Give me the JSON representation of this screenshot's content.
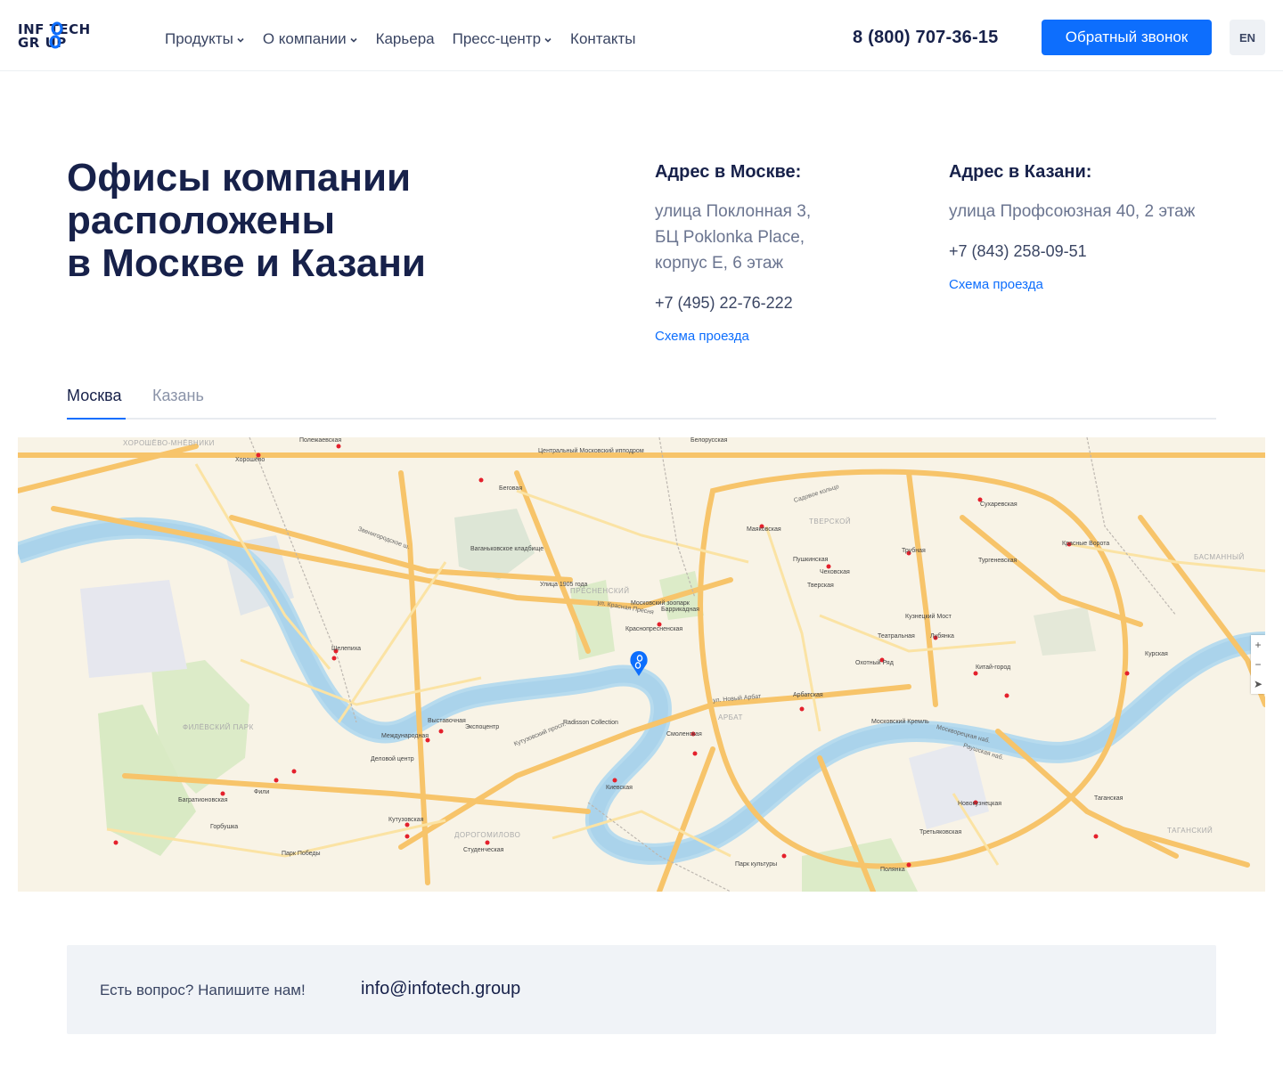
{
  "brand": {
    "line1": "INF TECH",
    "line2": "GR UP",
    "accent": "#0d6efd",
    "dark": "#17214a"
  },
  "nav": [
    {
      "label": "Продукты",
      "dropdown": true
    },
    {
      "label": "О компании",
      "dropdown": true
    },
    {
      "label": "Карьера",
      "dropdown": false
    },
    {
      "label": "Пресс-центр",
      "dropdown": true
    },
    {
      "label": "Контакты",
      "dropdown": false
    }
  ],
  "header": {
    "phone": "8 (800) 707-36-15",
    "callback_label": "Обратный звонок",
    "lang": "EN"
  },
  "title": {
    "line1": "Офисы компании",
    "line2": "расположены",
    "line3": "в Москве и Казани"
  },
  "moscow": {
    "heading": "Адрес в Москве:",
    "street1": "улица Поклонная 3,",
    "street2": "БЦ Poklonka Place,",
    "street3": "корпус Е, 6 этаж",
    "phone": "+7 (495) 22-76-222",
    "route": "Схема проезда"
  },
  "kazan": {
    "heading": "Адрес в Казани:",
    "street1": "улица Профсоюзная 40, 2 этаж",
    "phone": "+7 (843) 258-09-51",
    "route": "Схема проезда"
  },
  "tabs": {
    "moscow": "Москва",
    "kazan": "Казань",
    "active": "Москва"
  },
  "map": {
    "labels": {
      "khoroshevo": "ХОРОШЁВО-МНЁВНИКИ",
      "presnensky": "ПРЕСНЕНСКИЙ",
      "arbat": "АРБАТ",
      "tverskoy": "ТВЕРСКОЙ",
      "basmanny": "БАСМАННЫЙ",
      "tagansky": "ТАГАНСКИЙ",
      "dorogomilovo": "ДОРОГОМИЛОВО",
      "filevsky_park": "ФИЛЁВСКИЙ ПАРК",
      "kutuzovsky": "Кутузовский просп.",
      "novy_arbat": "ул. Новый Арбат",
      "krasnaya_presnya": "ул. Красная Пресня",
      "zvenigorodskoe": "Звенигородское ш.",
      "sadovoe": "Садовое кольцо",
      "moskvoretskaya": "Москворецкая наб.",
      "kievskaya": "Киевская",
      "smolenskaya": "Смоленская",
      "tretyakovskaya": "Третьяковская",
      "park_kultury": "Парк культуры",
      "park_pobedy": "Парк Победы",
      "kutuzovskaya": "Кутузовская",
      "vystavochnaya": "Выставочная",
      "mezhdunarodnaya": "Международная",
      "delovoy": "Деловой центр",
      "barrikadnaya": "Баррикадная",
      "krasnopresnenskaya": "Краснопресненская",
      "pushkinskaya": "Пушкинская",
      "tverskaya": "Тверская",
      "chekhovskaya": "Чеховская",
      "teatralnaya": "Театральная",
      "lubyanka": "Лубянка",
      "kitay_gorod": "Китай-город",
      "arbatskaya": "Арбатская",
      "kremlin": "Московский Кремль",
      "taganskaya": "Таганская",
      "kurskaya": "Курская",
      "belorusskaya": "Белорусская",
      "mayakovskaya": "Маяковская",
      "krasnye_vorota": "Красные Ворота",
      "polezhaevskaya": "Полежаевская",
      "khoroshevo_st": "Хорошёво",
      "shelepikha": "Шелепиха",
      "fili": "Фили",
      "bagrationovskaya": "Багратионовская",
      "gorbushka": "Горбушка",
      "novokuznetskaya": "Новокузнецкая",
      "polyanka": "Полянка",
      "ulitsa_1905": "Улица 1905 года",
      "begovaya": "Беговая",
      "sukharevskaya": "Сухаревская",
      "turgenevskaya": "Тургеневская",
      "trubnaya": "Трубная",
      "kuznetsky_most": "Кузнецкий Мост",
      "okhotny_ryad": "Охотный Ряд",
      "paveletskaya_naberezhnaya": "Раушская наб.",
      "studencheskaya": "Студенческая",
      "ekspocentr": "Экспоцентр",
      "radisson": "Radisson Collection",
      "zoo": "Московский зоопарк",
      "hippodrome": "Центральный Московский ипподром",
      "vagankovskoe": "Ваганьковское кладбище"
    }
  }
}
